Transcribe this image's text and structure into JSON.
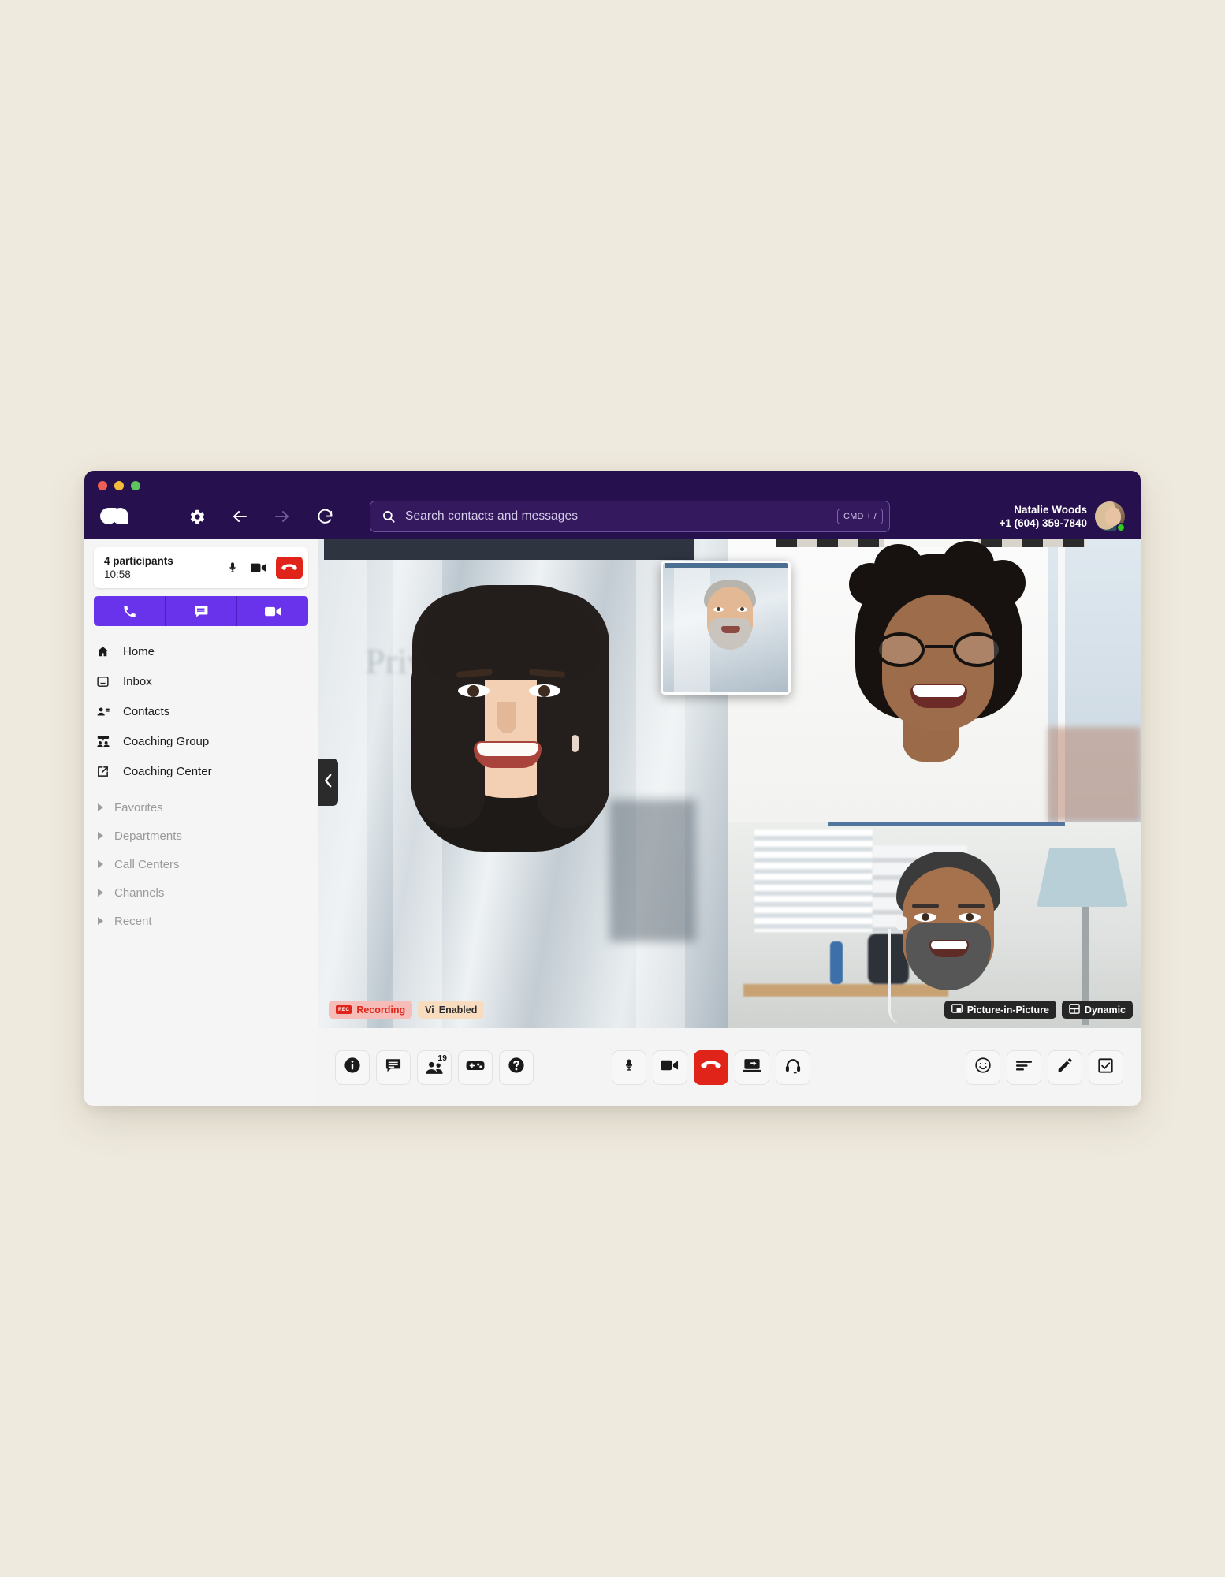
{
  "window": {
    "traffic_lights": [
      "close",
      "minimize",
      "maximize"
    ],
    "brand_logo": "dialpad-logo-icon"
  },
  "header": {
    "settings_icon": "gear-icon",
    "back_icon": "arrow-left-icon",
    "forward_icon": "arrow-right-icon",
    "reload_icon": "refresh-icon",
    "search": {
      "icon": "search-icon",
      "placeholder": "Search contacts and messages",
      "value": "",
      "shortcut": "CMD + /"
    },
    "user": {
      "name": "Natalie Woods",
      "phone": "+1 (604) 359-7840",
      "presence": "online",
      "avatar": "user-avatar"
    }
  },
  "sidebar": {
    "call_card": {
      "participants": "4 participants",
      "timer": "10:58",
      "mic_icon": "microphone-icon",
      "video_icon": "video-camera-icon",
      "end_icon": "end-call-icon"
    },
    "quick_actions": [
      {
        "name": "phone-call",
        "icon": "phone-icon"
      },
      {
        "name": "message",
        "icon": "chat-icon"
      },
      {
        "name": "video-call",
        "icon": "video-camera-icon"
      }
    ],
    "nav_items": [
      {
        "label": "Home",
        "icon": "home-icon"
      },
      {
        "label": "Inbox",
        "icon": "inbox-icon"
      },
      {
        "label": "Contacts",
        "icon": "contacts-icon"
      },
      {
        "label": "Coaching Group",
        "icon": "coaching-group-icon"
      },
      {
        "label": "Coaching Center",
        "icon": "external-link-icon"
      }
    ],
    "sections": [
      {
        "label": "Favorites",
        "expanded": false
      },
      {
        "label": "Departments",
        "expanded": false
      },
      {
        "label": "Call Centers",
        "expanded": false
      },
      {
        "label": "Channels",
        "expanded": false
      },
      {
        "label": "Recent",
        "expanded": false
      }
    ]
  },
  "video": {
    "collapse_icon": "chevron-left-icon",
    "tiles": [
      {
        "name": "main-speaker",
        "position": "left-large"
      },
      {
        "name": "participant-top-right",
        "position": "top-right"
      },
      {
        "name": "participant-bottom-right",
        "position": "bottom-right"
      },
      {
        "name": "self-view-pip",
        "position": "floating"
      }
    ],
    "badges_left": [
      {
        "label": "Recording",
        "chip": "REC",
        "type": "recording"
      },
      {
        "label": "Enabled",
        "chip": "Vi",
        "type": "vi"
      }
    ],
    "badges_right": [
      {
        "label": "Picture-in-Picture",
        "icon": "pip-icon"
      },
      {
        "label": "Dynamic",
        "icon": "grid-layout-icon"
      }
    ]
  },
  "toolbar": {
    "left_group": [
      {
        "name": "call-info-button",
        "icon": "info-icon",
        "badge": ""
      },
      {
        "name": "chat-button",
        "icon": "chat-icon",
        "badge": ""
      },
      {
        "name": "participants-button",
        "icon": "people-icon",
        "badge": "19"
      },
      {
        "name": "games-button",
        "icon": "controller-icon",
        "badge": ""
      },
      {
        "name": "help-button",
        "icon": "question-icon",
        "badge": ""
      }
    ],
    "center_group": [
      {
        "name": "mute-button",
        "icon": "microphone-icon",
        "style": "default"
      },
      {
        "name": "camera-button",
        "icon": "video-camera-icon",
        "style": "default"
      },
      {
        "name": "end-call-button",
        "icon": "end-call-icon",
        "style": "danger"
      },
      {
        "name": "share-screen-button",
        "icon": "screen-share-icon",
        "style": "default"
      },
      {
        "name": "audio-device-button",
        "icon": "headset-icon",
        "style": "default"
      }
    ],
    "right_group": [
      {
        "name": "reactions-button",
        "icon": "smiley-icon"
      },
      {
        "name": "transcript-button",
        "icon": "list-lines-icon"
      },
      {
        "name": "whiteboard-button",
        "icon": "pencil-icon"
      },
      {
        "name": "tasks-button",
        "icon": "checkbox-icon"
      }
    ]
  },
  "colors": {
    "brand_purple": "#26104d",
    "accent_purple": "#6933ec",
    "danger_red": "#e0241a",
    "presence_green": "#2ecc1f",
    "page_background": "#efeade"
  }
}
